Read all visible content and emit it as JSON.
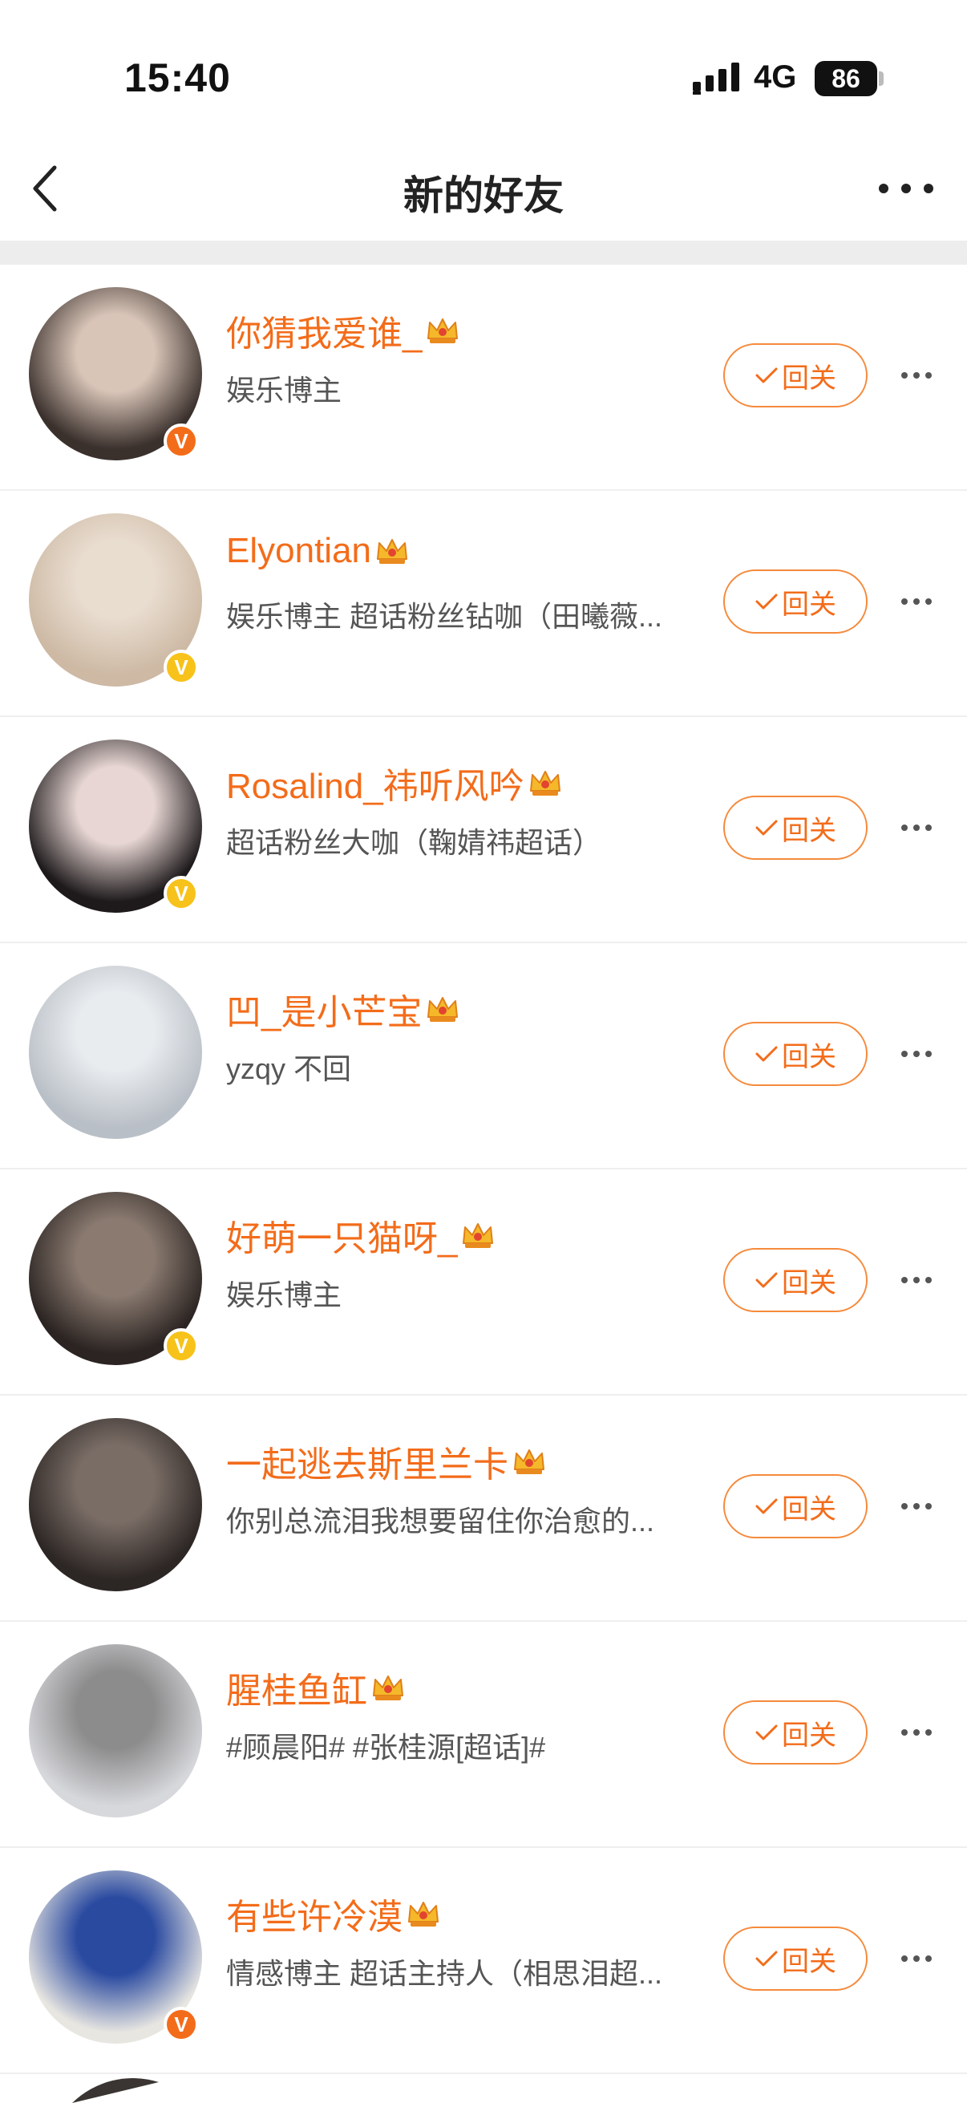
{
  "status_bar": {
    "time": "15:40",
    "network": "4G",
    "battery": "86"
  },
  "nav": {
    "title": "新的好友",
    "back_icon": "chevron-left-icon",
    "more_icon": "more-horizontal-icon"
  },
  "colors": {
    "accent": "#f36c1a",
    "badge_orange": "#f36c1a",
    "badge_yellow": "#f7c21a",
    "divider": "#ededed"
  },
  "follow_label": "回关",
  "rows": [
    {
      "name": "你猜我爱谁_",
      "desc": "娱乐博主",
      "badge": "V",
      "badge_color": "orange",
      "avatar": [
        "#3a302c",
        "#d9c5b8"
      ]
    },
    {
      "name": "Elyontian",
      "desc": "娱乐博主 超话粉丝钻咖（田曦薇...",
      "badge": "V",
      "badge_color": "yellow",
      "avatar": [
        "#cdb9a4",
        "#e9ddd0"
      ]
    },
    {
      "name": "Rosalind_祎听风吟",
      "desc": "超话粉丝大咖（鞠婧祎超话）",
      "badge": "V",
      "badge_color": "yellow",
      "avatar": [
        "#1e1a1c",
        "#e7d6d3"
      ]
    },
    {
      "name": "凹_是小芒宝",
      "desc": "yzqy 不回",
      "badge": "",
      "badge_color": "",
      "avatar": [
        "#b9bfc6",
        "#e9ecef"
      ]
    },
    {
      "name": "好萌一只猫呀_",
      "desc": "娱乐博主",
      "badge": "V",
      "badge_color": "yellow",
      "avatar": [
        "#2b2422",
        "#8a7a70"
      ]
    },
    {
      "name": "一起逃去斯里兰卡",
      "desc": "你别总流泪我想要留住你治愈的...",
      "badge": "",
      "badge_color": "",
      "avatar": [
        "#2c2624",
        "#7a6d66"
      ]
    },
    {
      "name": "腥桂鱼缸",
      "desc": "#顾晨阳# #张桂源[超话]#",
      "badge": "",
      "badge_color": "",
      "avatar": [
        "#d7d8dc",
        "#8c8c8c"
      ]
    },
    {
      "name": "有些许冷漠",
      "desc": "情感博主 超话主持人（相思泪超...",
      "badge": "V",
      "badge_color": "orange",
      "avatar": [
        "#e8e6e1",
        "#2a4aa0"
      ]
    }
  ]
}
